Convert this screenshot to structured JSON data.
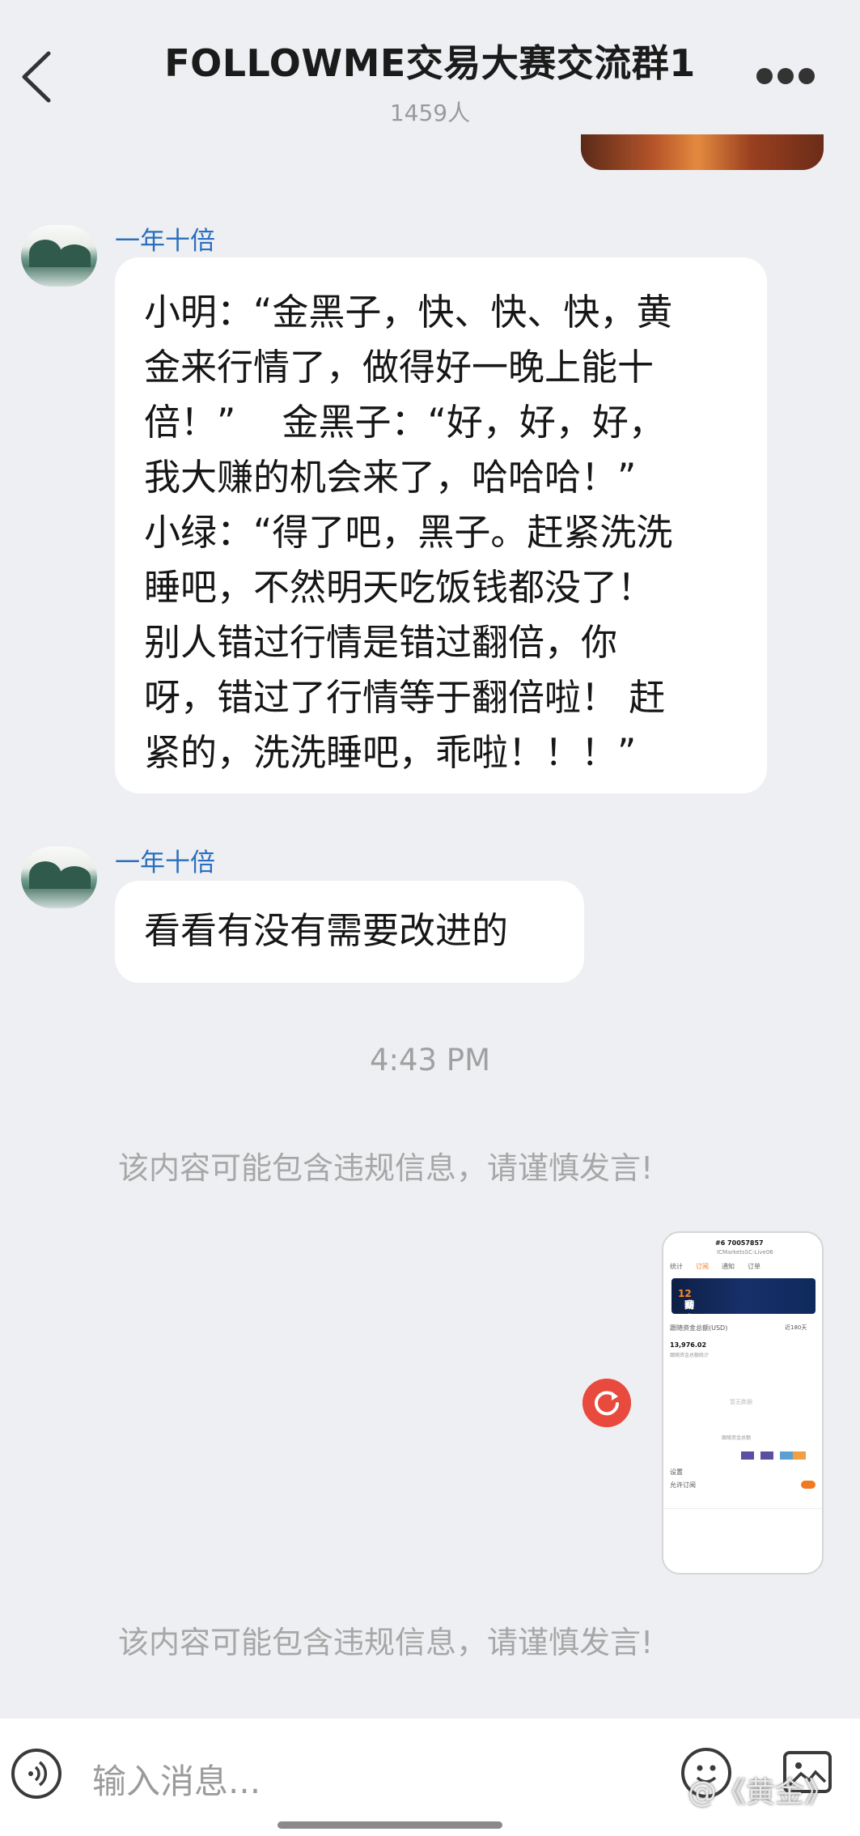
{
  "header": {
    "back_icon": "chevron-left-icon",
    "title": "FOLLOWME交易大赛交流群1",
    "member_count": "1459人",
    "more_icon": "more-dots-icon"
  },
  "messages": [
    {
      "sender": "一年十倍",
      "lines": [
        "小明：“金黑子，快、快、快，黄",
        "金来行情了，做得好一晚上能十",
        "倍！”    金黑子：“好，好，好，",
        "我大赚的机会来了，哈哈哈！”",
        "小绿：“得了吧，黑子。赶紧洗洗",
        "睡吧，不然明天吃饭钱都没了！",
        "别人错过行情是错过翻倍，你",
        "呀，错过了行情等于翻倍啦！ 赶",
        "紧的，洗洗睡吧，乖啦！！！”"
      ]
    },
    {
      "sender": "一年十倍",
      "lines": [
        "看看有没有需要改进的"
      ]
    }
  ],
  "timestamp": "4:43 PM",
  "warnings": [
    "该内容可能包含违规信息，请谨慎发言!",
    "该内容可能包含违规信息，请谨慎发言!"
  ],
  "retry_icon": "retry-icon",
  "screenshot_thumb": {
    "account": "#6  70057857",
    "server": "ICMarketsSC-Live06",
    "tabs": [
      "统计",
      "订阅",
      "通知",
      "订单"
    ],
    "banner": "赛事再起航",
    "banner_num": "12",
    "banner_suffix": "动",
    "section": "跟随资金总额(USD)",
    "range": "近180天",
    "amount": "13,976.02",
    "amount_label": "跟随资金总额统计",
    "empty": "暂无数据",
    "legend": "跟随资金总额",
    "settings": "设置",
    "allow": "允许订阅"
  },
  "input": {
    "placeholder": "输入消息...",
    "watermark": "@《黄金》"
  },
  "colors": {
    "accent": "#2a6fbf",
    "alert": "#e84a3e",
    "background": "#eeeff2"
  }
}
